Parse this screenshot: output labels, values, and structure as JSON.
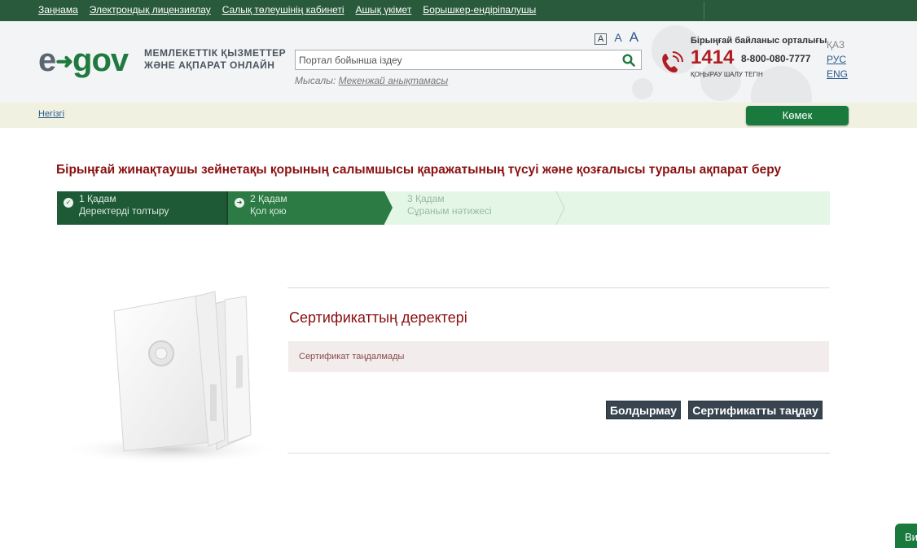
{
  "topnav": {
    "links": [
      "Заңнама",
      "Электрондық лицензиялау",
      "Салық төлеушінің кабинеті",
      "Ашық үкімет",
      "Борышкер-ендіріпалушы"
    ]
  },
  "header": {
    "logo_e": "e",
    "logo_gov": "gov",
    "tagline_line1": "МЕМЛЕКЕТТІК ҚЫЗМЕТТЕР",
    "tagline_line2": "ЖӘНЕ АҚПАРАТ ОНЛАЙН",
    "font_sizes": [
      "A",
      "A",
      "A"
    ],
    "search_placeholder": "Портал бойынша іздеу",
    "example_label": "Мысалы:",
    "example_link": "Мекенжай анықтамасы",
    "contact_title": "Бірыңғай байланыс орталығы",
    "contact_number": "1414",
    "contact_alt_number": "8-800-080-7777",
    "contact_free": "ҚОҢЫРАУ ШАЛУ ТЕГІН",
    "languages": {
      "current": "ҚАЗ",
      "ru": "РУС",
      "en": "ENG"
    }
  },
  "breadcrumb": {
    "home": "Негізгі"
  },
  "help_button": "Көмек",
  "page_title": "Бірыңғай жинақтаушы зейнетақы қорының салымшысы қаражатының түсуі және қозғалысы туралы ақпарат беру",
  "steps": [
    {
      "num": "1 Қадам",
      "name": "Деректерді толтыру",
      "state": "done"
    },
    {
      "num": "2 Қадам",
      "name": "Қол қою",
      "state": "active"
    },
    {
      "num": "3 Қадам",
      "name": "Сұраным нәтижесі",
      "state": "pending"
    }
  ],
  "certificate": {
    "title": "Сертификаттың деректері",
    "message": "Сертификат таңдалмады",
    "cancel_button": "Болдырмау",
    "select_button": "Сертификатты таңдау"
  },
  "corner_button": "Ви",
  "colors": {
    "topbar": "#2a5a3c",
    "brand_green": "#1f7a3f",
    "title_red": "#8b0f10",
    "button_dark": "#384550"
  }
}
